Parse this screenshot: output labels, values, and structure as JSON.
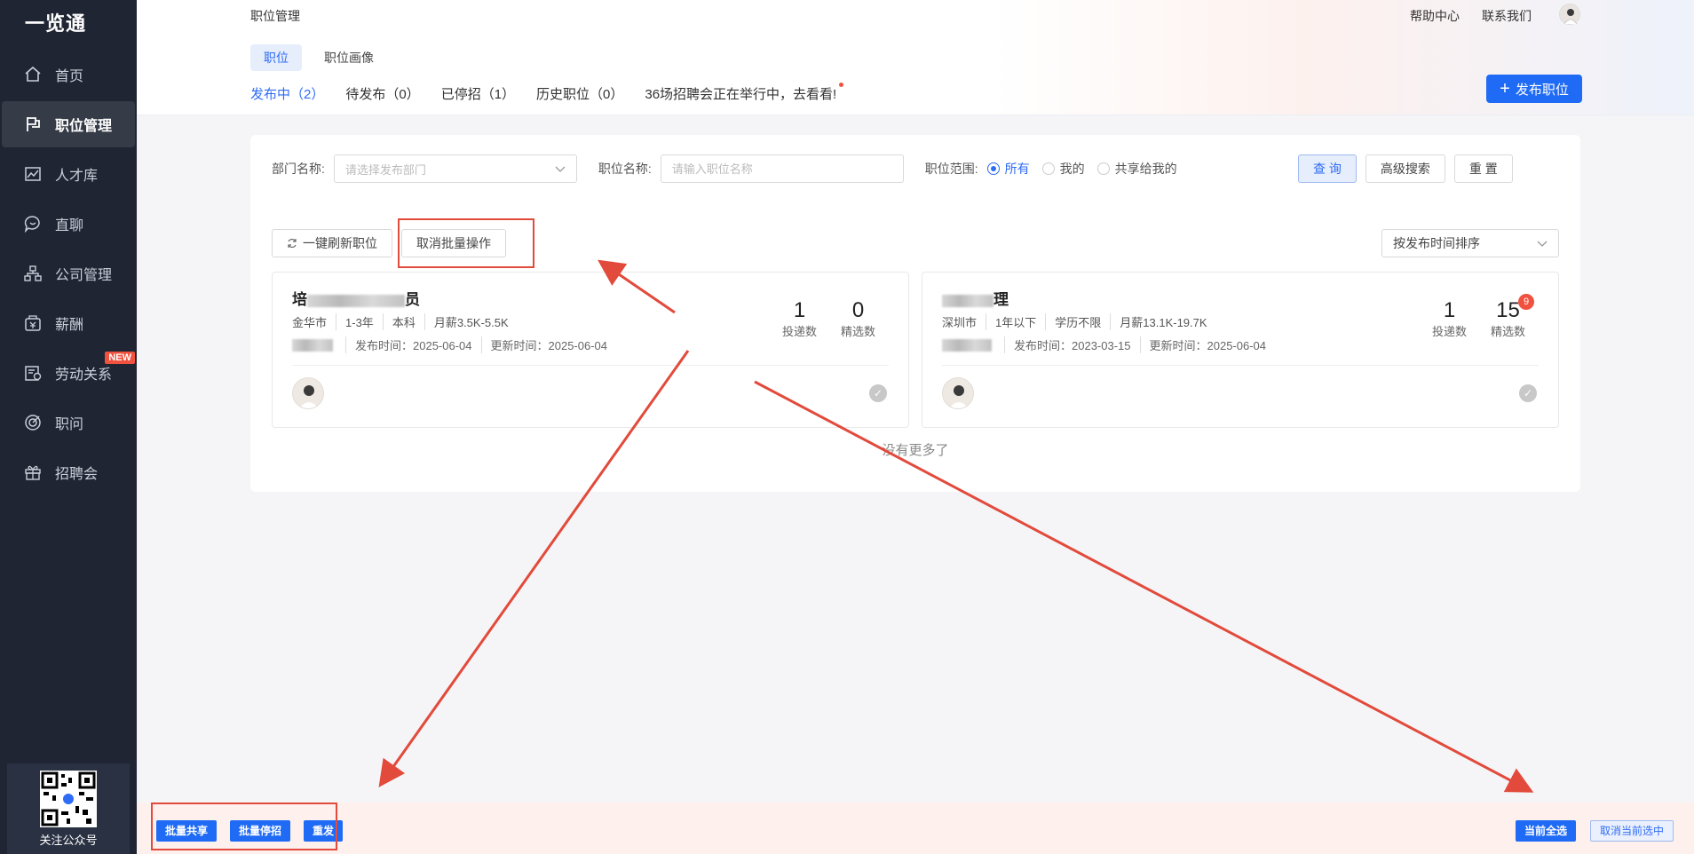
{
  "app": {
    "logo": "一览通"
  },
  "sidebar": {
    "items": [
      {
        "label": "首页",
        "icon": "home-icon"
      },
      {
        "label": "职位管理",
        "icon": "flag-icon",
        "active": true
      },
      {
        "label": "人才库",
        "icon": "trend-icon"
      },
      {
        "label": "直聊",
        "icon": "chat-icon"
      },
      {
        "label": "公司管理",
        "icon": "org-chart-icon"
      },
      {
        "label": "薪酬",
        "icon": "salary-icon"
      },
      {
        "label": "劳动关系",
        "icon": "contract-icon",
        "badge": "NEW"
      },
      {
        "label": "职问",
        "icon": "target-icon"
      },
      {
        "label": "招聘会",
        "icon": "gift-icon"
      }
    ],
    "qr_label": "关注公众号"
  },
  "header": {
    "title": "职位管理",
    "help": "帮助中心",
    "contact": "联系我们",
    "tabs": [
      {
        "label": "职位",
        "active": true
      },
      {
        "label": "职位画像"
      }
    ],
    "status": [
      {
        "label": "发布中（2）",
        "active": true
      },
      {
        "label": "待发布（0）"
      },
      {
        "label": "已停招（1）"
      },
      {
        "label": "历史职位（0）"
      },
      {
        "label": "36场招聘会正在举行中，去看看!"
      }
    ],
    "publish_button": "发布职位"
  },
  "filters": {
    "dept_label": "部门名称:",
    "dept_placeholder": "请选择发布部门",
    "job_label": "职位名称:",
    "job_placeholder": "请输入职位名称",
    "scope_label": "职位范围:",
    "scope_options": [
      {
        "label": "所有",
        "checked": true
      },
      {
        "label": "我的"
      },
      {
        "label": "共享给我的"
      }
    ],
    "query_button": "查 询",
    "advanced_button": "高级搜索",
    "reset_button": "重 置"
  },
  "actions": {
    "refresh_button": "一键刷新职位",
    "cancel_batch_button": "取消批量操作",
    "sort_label": "按发布时间排序"
  },
  "jobs": [
    {
      "title_prefix": "培",
      "title_suffix": "员",
      "location": "金华市",
      "experience": "1-3年",
      "education": "本科",
      "salary": "月薪3.5K-5.5K",
      "publish_time": "发布时间：2025-06-04",
      "update_time": "更新时间：2025-06-04",
      "applications": "1",
      "applications_label": "投递数",
      "selected": "0",
      "selected_label": "精选数"
    },
    {
      "title_prefix": "",
      "title_suffix": "理",
      "location": "深圳市",
      "experience": "1年以下",
      "education": "学历不限",
      "salary": "月薪13.1K-19.7K",
      "publish_time": "发布时间：2023-03-15",
      "update_time": "更新时间：2025-06-04",
      "applications": "1",
      "applications_label": "投递数",
      "selected": "15",
      "selected_label": "精选数",
      "badge": "9"
    }
  ],
  "no_more": "没有更多了",
  "bottom_bar": {
    "batch_share": "批量共享",
    "batch_stop": "批量停招",
    "republish": "重发",
    "select_all": "当前全选",
    "cancel_selection": "取消当前选中"
  },
  "colors": {
    "primary": "#1f6bf5",
    "sidebar_bg": "#1f2533",
    "annotation_red": "#e24a3b",
    "badge_red": "#f0523f"
  }
}
